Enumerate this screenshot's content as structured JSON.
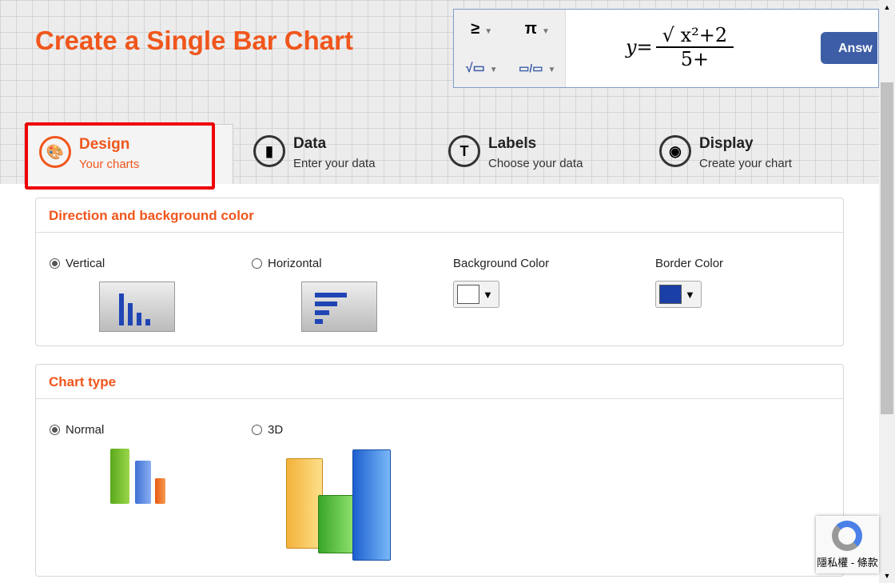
{
  "header": {
    "title": "Create a Single Bar Chart"
  },
  "equation_ad": {
    "tools": [
      "≥",
      "π",
      "√▭",
      "▭/▭"
    ],
    "formula_lhs": "y=",
    "formula_numerator": "√ x²+2",
    "formula_denominator": "5+",
    "answer_label": "Answ"
  },
  "tabs": [
    {
      "label": "Design",
      "sub": "Your charts",
      "icon": "palette-icon",
      "active": true
    },
    {
      "label": "Data",
      "sub": "Enter your data",
      "icon": "bar-chart-icon"
    },
    {
      "label": "Labels",
      "sub": "Choose your data",
      "icon": "text-icon"
    },
    {
      "label": "Display",
      "sub": "Create your chart",
      "icon": "eye-icon"
    }
  ],
  "direction": {
    "title": "Direction and background color",
    "vertical": "Vertical",
    "horizontal": "Horizontal",
    "selected": "Vertical",
    "bg_label": "Background Color",
    "bg_color": "#ffffff",
    "border_label": "Border Color",
    "border_color": "#1a3fa6"
  },
  "chart_type": {
    "title": "Chart type",
    "normal": "Normal",
    "threed": "3D",
    "selected": "Normal"
  },
  "recaptcha": {
    "text": "隱私權 - 條款"
  },
  "colors": {
    "accent": "#f0561c",
    "highlight": "#e00000"
  }
}
